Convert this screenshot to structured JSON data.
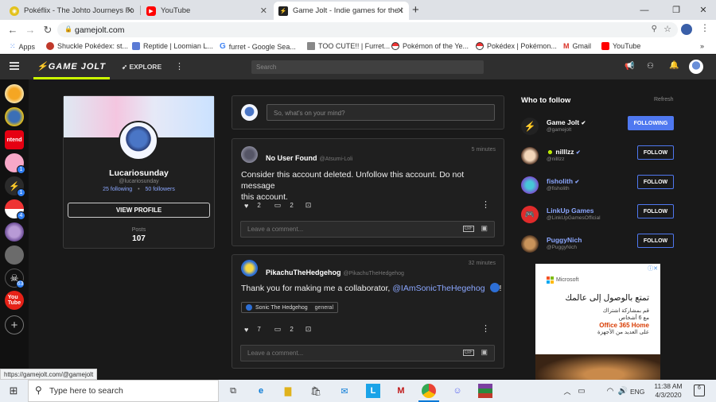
{
  "browser": {
    "tabs": [
      {
        "title": "Pokéflix - The Johto Journeys Fo",
        "close": "✕"
      },
      {
        "title": "YouTube",
        "close": "✕"
      },
      {
        "title": "Game Jolt - Indie games for the l",
        "close": "✕"
      }
    ],
    "new_tab": "+",
    "window_controls": {
      "minimize": "—",
      "maximize": "❐",
      "close": "✕"
    },
    "url": "gamejolt.com",
    "bookmarks": [
      "Apps",
      "Shuckle Pokédex: st...",
      "Reptide | Loomian L...",
      "furret - Google Sea...",
      "TOO CUTE!! | Furret...",
      "Pokémon of the Ye...",
      "Pokédex | Pokémon...",
      "Gmail",
      "YouTube"
    ],
    "bookmarks_more": "»"
  },
  "gj": {
    "logo": "GAME JOLT",
    "explore": "EXPLORE",
    "search_placeholder": "Search"
  },
  "sidebar": {
    "badges": [
      "1",
      "1",
      "4",
      "63"
    ],
    "add": "+",
    "nintendo_label": "ntend"
  },
  "profile": {
    "name": "Lucariosunday",
    "handle": "@lucariosunday",
    "following": "25 following",
    "dot": "•",
    "followers": "50 followers",
    "view_profile": "VIEW PROFILE",
    "posts_label": "Posts",
    "posts_count": "107"
  },
  "composer": {
    "placeholder": "So, what's on your mind?"
  },
  "posts": [
    {
      "name": "No User Found",
      "handle": "@Atsumi-Loli",
      "time": "5 minutes",
      "text1": "Consider this account deleted. Unfollow this account. Do not message",
      "text2": "this account.",
      "likes": "2",
      "comments": "2",
      "comment_placeholder": "Leave a comment...",
      "gif": "GIF"
    },
    {
      "name": "PikachuTheHedgehog",
      "handle": "@PikachuTheHedgehog",
      "time": "32 minutes",
      "text": "Thank you for making me a collaborator, ",
      "mention": "@IAmSonicTheHegehog",
      "text_end": "!",
      "tag_game": "Sonic The Hedgehog",
      "tag_channel": "general",
      "likes": "7",
      "comments": "2",
      "comment_placeholder": "Leave a comment...",
      "gif": "GIF"
    }
  ],
  "who_to_follow": {
    "title": "Who to follow",
    "refresh": "Refresh",
    "users": [
      {
        "name": "Game Jolt",
        "handle": "@gamejolt",
        "button": "FOLLOWING"
      },
      {
        "name": "nilllzz",
        "handle": "@nilllzz",
        "button": "FOLLOW"
      },
      {
        "name": "fisholith",
        "handle": "@fisholith",
        "button": "FOLLOW"
      },
      {
        "name": "LinkUp Games",
        "handle": "@LinkUpGamesOfficial",
        "button": "FOLLOW"
      },
      {
        "name": "PuggyNich",
        "handle": "@PuggyNich",
        "button": "FOLLOW"
      }
    ]
  },
  "ad": {
    "brand": "Microsoft",
    "headline": "تمتع بالوصول إلى عالمك",
    "line1": "قم بمشاركة اشتراك",
    "line2": "مع 6 أشخاص",
    "product": "Office 365 Home",
    "line3": "على العديد من الأجهزة",
    "info": "ⓘ✕"
  },
  "status_url": "https://gamejolt.com/@gamejolt",
  "taskbar": {
    "search_placeholder": "Type here to search",
    "lang": "ENG",
    "time": "11:38 AM",
    "date": "4/3/2020",
    "notif": "6"
  },
  "colors": {
    "accent_green": "#2f7f6f",
    "gj_green": "#ccff00",
    "link_blue": "#8ba7ff",
    "follow_blue": "#4f78f0"
  }
}
